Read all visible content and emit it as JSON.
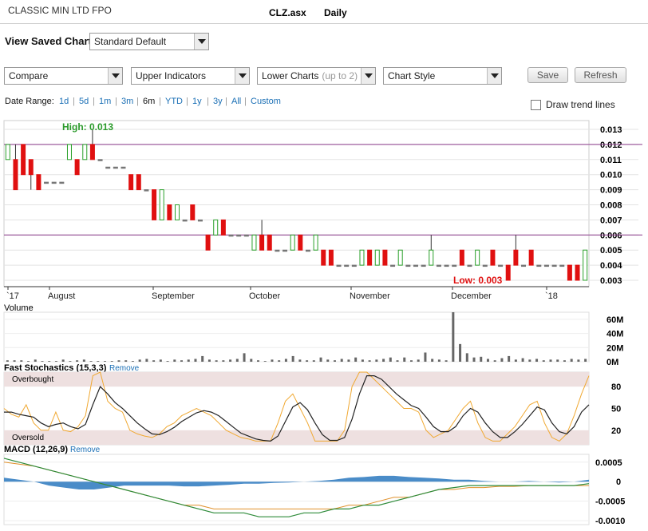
{
  "header": {
    "company": "CLASSIC MIN LTD FPO",
    "ticker": "CLZ.asx",
    "period": "Daily"
  },
  "saved_chart": {
    "label": "View Saved Chart:",
    "value": "Standard Default"
  },
  "toolbar": {
    "compare": "Compare",
    "upper": "Upper Indicators",
    "lower": "Lower Charts",
    "lower_hint": "(up to 2)",
    "style": "Chart Style",
    "save": "Save",
    "refresh": "Refresh"
  },
  "date_range": {
    "label": "Date Range:",
    "options": [
      "1d",
      "5d",
      "1m",
      "3m",
      "6m",
      "YTD",
      "1y",
      "3y",
      "All",
      "Custom"
    ],
    "selected": "6m"
  },
  "draw_trend": "Draw trend lines",
  "chart": {
    "high_label": "High: 0.013",
    "low_label": "Low: 0.003",
    "price_ticks": [
      "0.013",
      "0.012",
      "0.011",
      "0.010",
      "0.009",
      "0.008",
      "0.007",
      "0.006",
      "0.005",
      "0.004",
      "0.003"
    ],
    "x_labels": [
      "`17",
      "August",
      "September",
      "October",
      "November",
      "December",
      "`18"
    ],
    "volume_title": "Volume",
    "volume_ticks": [
      "60M",
      "40M",
      "20M",
      "0M"
    ],
    "stoch_title": "Fast Stochastics (15,3,3)",
    "stoch_remove": "Remove",
    "overbought": "Overbought",
    "oversold": "Oversold",
    "stoch_ticks": [
      "80",
      "50",
      "20"
    ],
    "macd_title": "MACD (12,26,9)",
    "macd_remove": "Remove",
    "macd_ticks": [
      "0.0005",
      "0",
      "-0.0005",
      "-0.0010"
    ],
    "colors": {
      "up": "#2aa02a",
      "down": "#e01010",
      "flat": "#777777",
      "trend": "#8b3a8b",
      "k_line": "#f0a830",
      "d_line": "#222222",
      "macd": "#2e8b3a",
      "signal": "#e0902a",
      "hist": "#4a8cc8"
    }
  },
  "chart_data": {
    "type": "candlestick",
    "y_range": [
      0.003,
      0.013
    ],
    "candles": [
      {
        "o": 0.011,
        "c": 0.012,
        "h": 0.012,
        "l": 0.011
      },
      {
        "o": 0.011,
        "c": 0.009,
        "h": 0.012,
        "l": 0.009
      },
      {
        "o": 0.012,
        "c": 0.01,
        "h": 0.012,
        "l": 0.01
      },
      {
        "o": 0.011,
        "c": 0.01,
        "h": 0.011,
        "l": 0.009
      },
      {
        "o": 0.01,
        "c": 0.009,
        "h": 0.01,
        "l": 0.009
      },
      {
        "o": 0.0095,
        "c": 0.0095,
        "h": 0.0095,
        "l": 0.0095
      },
      {
        "o": 0.0095,
        "c": 0.0095,
        "h": 0.0095,
        "l": 0.0095
      },
      {
        "o": 0.0095,
        "c": 0.0095,
        "h": 0.0095,
        "l": 0.0095
      },
      {
        "o": 0.011,
        "c": 0.012,
        "h": 0.012,
        "l": 0.011
      },
      {
        "o": 0.011,
        "c": 0.01,
        "h": 0.011,
        "l": 0.01
      },
      {
        "o": 0.011,
        "c": 0.012,
        "h": 0.012,
        "l": 0.011
      },
      {
        "o": 0.012,
        "c": 0.011,
        "h": 0.013,
        "l": 0.011
      },
      {
        "o": 0.011,
        "c": 0.011,
        "h": 0.011,
        "l": 0.011
      },
      {
        "o": 0.0105,
        "c": 0.0105,
        "h": 0.0105,
        "l": 0.0105
      },
      {
        "o": 0.0105,
        "c": 0.0105,
        "h": 0.0105,
        "l": 0.0105
      },
      {
        "o": 0.0105,
        "c": 0.0105,
        "h": 0.0105,
        "l": 0.0105
      },
      {
        "o": 0.01,
        "c": 0.009,
        "h": 0.01,
        "l": 0.009
      },
      {
        "o": 0.01,
        "c": 0.009,
        "h": 0.01,
        "l": 0.009
      },
      {
        "o": 0.009,
        "c": 0.009,
        "h": 0.009,
        "l": 0.009
      },
      {
        "o": 0.009,
        "c": 0.007,
        "h": 0.009,
        "l": 0.007
      },
      {
        "o": 0.007,
        "c": 0.009,
        "h": 0.009,
        "l": 0.007
      },
      {
        "o": 0.008,
        "c": 0.007,
        "h": 0.008,
        "l": 0.007
      },
      {
        "o": 0.007,
        "c": 0.008,
        "h": 0.008,
        "l": 0.007
      },
      {
        "o": 0.007,
        "c": 0.007,
        "h": 0.007,
        "l": 0.007
      },
      {
        "o": 0.008,
        "c": 0.007,
        "h": 0.008,
        "l": 0.007
      },
      {
        "o": 0.007,
        "c": 0.007,
        "h": 0.007,
        "l": 0.007
      },
      {
        "o": 0.006,
        "c": 0.005,
        "h": 0.006,
        "l": 0.005
      },
      {
        "o": 0.006,
        "c": 0.007,
        "h": 0.007,
        "l": 0.006
      },
      {
        "o": 0.007,
        "c": 0.006,
        "h": 0.007,
        "l": 0.006
      },
      {
        "o": 0.006,
        "c": 0.006,
        "h": 0.006,
        "l": 0.006
      },
      {
        "o": 0.006,
        "c": 0.006,
        "h": 0.006,
        "l": 0.006
      },
      {
        "o": 0.006,
        "c": 0.006,
        "h": 0.006,
        "l": 0.006
      },
      {
        "o": 0.005,
        "c": 0.006,
        "h": 0.006,
        "l": 0.005
      },
      {
        "o": 0.006,
        "c": 0.005,
        "h": 0.007,
        "l": 0.005
      },
      {
        "o": 0.006,
        "c": 0.005,
        "h": 0.006,
        "l": 0.005
      },
      {
        "o": 0.005,
        "c": 0.005,
        "h": 0.005,
        "l": 0.005
      },
      {
        "o": 0.005,
        "c": 0.005,
        "h": 0.005,
        "l": 0.005
      },
      {
        "o": 0.005,
        "c": 0.006,
        "h": 0.006,
        "l": 0.005
      },
      {
        "o": 0.006,
        "c": 0.005,
        "h": 0.006,
        "l": 0.005
      },
      {
        "o": 0.005,
        "c": 0.005,
        "h": 0.005,
        "l": 0.005
      },
      {
        "o": 0.005,
        "c": 0.006,
        "h": 0.006,
        "l": 0.005
      },
      {
        "o": 0.005,
        "c": 0.004,
        "h": 0.005,
        "l": 0.004
      },
      {
        "o": 0.005,
        "c": 0.004,
        "h": 0.005,
        "l": 0.004
      },
      {
        "o": 0.004,
        "c": 0.004,
        "h": 0.004,
        "l": 0.004
      },
      {
        "o": 0.004,
        "c": 0.004,
        "h": 0.004,
        "l": 0.004
      },
      {
        "o": 0.004,
        "c": 0.004,
        "h": 0.004,
        "l": 0.004
      },
      {
        "o": 0.004,
        "c": 0.005,
        "h": 0.005,
        "l": 0.004
      },
      {
        "o": 0.005,
        "c": 0.004,
        "h": 0.005,
        "l": 0.004
      },
      {
        "o": 0.004,
        "c": 0.005,
        "h": 0.005,
        "l": 0.004
      },
      {
        "o": 0.005,
        "c": 0.004,
        "h": 0.005,
        "l": 0.004
      },
      {
        "o": 0.004,
        "c": 0.004,
        "h": 0.004,
        "l": 0.004
      },
      {
        "o": 0.004,
        "c": 0.005,
        "h": 0.005,
        "l": 0.004
      },
      {
        "o": 0.004,
        "c": 0.004,
        "h": 0.004,
        "l": 0.004
      },
      {
        "o": 0.004,
        "c": 0.004,
        "h": 0.004,
        "l": 0.004
      },
      {
        "o": 0.004,
        "c": 0.004,
        "h": 0.004,
        "l": 0.004
      },
      {
        "o": 0.004,
        "c": 0.005,
        "h": 0.006,
        "l": 0.004
      },
      {
        "o": 0.004,
        "c": 0.004,
        "h": 0.004,
        "l": 0.004
      },
      {
        "o": 0.004,
        "c": 0.004,
        "h": 0.004,
        "l": 0.004
      },
      {
        "o": 0.004,
        "c": 0.004,
        "h": 0.004,
        "l": 0.004
      },
      {
        "o": 0.005,
        "c": 0.004,
        "h": 0.005,
        "l": 0.004
      },
      {
        "o": 0.004,
        "c": 0.004,
        "h": 0.004,
        "l": 0.004
      },
      {
        "o": 0.004,
        "c": 0.005,
        "h": 0.005,
        "l": 0.004
      },
      {
        "o": 0.004,
        "c": 0.004,
        "h": 0.004,
        "l": 0.004
      },
      {
        "o": 0.005,
        "c": 0.004,
        "h": 0.005,
        "l": 0.004
      },
      {
        "o": 0.004,
        "c": 0.004,
        "h": 0.004,
        "l": 0.004
      },
      {
        "o": 0.004,
        "c": 0.003,
        "h": 0.004,
        "l": 0.003
      },
      {
        "o": 0.005,
        "c": 0.004,
        "h": 0.006,
        "l": 0.004
      },
      {
        "o": 0.004,
        "c": 0.004,
        "h": 0.004,
        "l": 0.004
      },
      {
        "o": 0.005,
        "c": 0.004,
        "h": 0.005,
        "l": 0.004
      },
      {
        "o": 0.004,
        "c": 0.004,
        "h": 0.004,
        "l": 0.004
      },
      {
        "o": 0.004,
        "c": 0.004,
        "h": 0.004,
        "l": 0.004
      },
      {
        "o": 0.004,
        "c": 0.004,
        "h": 0.004,
        "l": 0.004
      },
      {
        "o": 0.004,
        "c": 0.004,
        "h": 0.004,
        "l": 0.004
      },
      {
        "o": 0.004,
        "c": 0.003,
        "h": 0.004,
        "l": 0.003
      },
      {
        "o": 0.004,
        "c": 0.003,
        "h": 0.004,
        "l": 0.003
      },
      {
        "o": 0.003,
        "c": 0.005,
        "h": 0.005,
        "l": 0.003
      }
    ],
    "trend_lines": [
      0.012,
      0.006
    ],
    "volume_M": [
      2,
      2,
      2,
      1,
      3,
      1,
      1,
      1,
      3,
      1,
      2,
      3,
      1,
      1,
      1,
      1,
      2,
      2,
      1,
      3,
      4,
      2,
      3,
      1,
      3,
      2,
      3,
      4,
      8,
      3,
      2,
      2,
      3,
      4,
      12,
      4,
      2,
      1,
      3,
      2,
      4,
      8,
      3,
      2,
      2,
      6,
      3,
      2,
      4,
      3,
      6,
      3,
      2,
      3,
      4,
      6,
      2,
      6,
      2,
      3,
      13,
      4,
      3,
      2,
      70,
      25,
      12,
      6,
      7,
      4,
      2,
      5,
      8,
      3,
      5,
      3,
      4,
      2,
      3,
      3,
      2,
      4,
      3,
      4
    ],
    "stoch_k": [
      50,
      42,
      38,
      55,
      30,
      20,
      20,
      45,
      20,
      18,
      25,
      40,
      95,
      100,
      60,
      50,
      45,
      20,
      15,
      12,
      10,
      15,
      25,
      30,
      40,
      45,
      50,
      45,
      40,
      30,
      20,
      15,
      10,
      8,
      5,
      5,
      5,
      30,
      60,
      70,
      50,
      30,
      5,
      5,
      5,
      5,
      20,
      80,
      100,
      100,
      90,
      80,
      70,
      60,
      50,
      50,
      45,
      20,
      10,
      15,
      20,
      35,
      50,
      60,
      30,
      10,
      5,
      5,
      15,
      25,
      40,
      55,
      60,
      30,
      10,
      5,
      15,
      40,
      70,
      95
    ],
    "stoch_d": [
      45,
      45,
      42,
      40,
      38,
      30,
      25,
      28,
      30,
      25,
      22,
      28,
      55,
      80,
      70,
      58,
      50,
      40,
      30,
      22,
      15,
      14,
      18,
      24,
      32,
      38,
      44,
      47,
      45,
      40,
      32,
      24,
      16,
      12,
      8,
      6,
      5,
      12,
      32,
      52,
      58,
      48,
      30,
      14,
      6,
      6,
      10,
      35,
      70,
      95,
      95,
      90,
      80,
      70,
      62,
      54,
      50,
      38,
      25,
      18,
      18,
      25,
      40,
      50,
      45,
      30,
      18,
      10,
      10,
      18,
      28,
      40,
      52,
      48,
      30,
      18,
      15,
      25,
      45,
      55
    ],
    "macd": [
      0.0006,
      0.0005,
      0.0004,
      0.0003,
      0.0002,
      0.0001,
      0.0,
      -0.0001,
      -0.0002,
      -0.0003,
      -0.0004,
      -0.0005,
      -0.0006,
      -0.0007,
      -0.0008,
      -0.0008,
      -0.0008,
      -0.0009,
      -0.0009,
      -0.0009,
      -0.0008,
      -0.0008,
      -0.0007,
      -0.0007,
      -0.0006,
      -0.0006,
      -0.0005,
      -0.0004,
      -0.0003,
      -0.0002,
      -0.00015,
      -0.0001,
      -0.0001,
      -0.0001,
      -0.0001,
      -0.0001,
      -0.0001,
      -0.0001,
      -0.0001,
      -5e-05
    ],
    "signal": [
      0.0005,
      0.00045,
      0.0004,
      0.0003,
      0.0002,
      0.0001,
      0.0,
      -0.0001,
      -0.0002,
      -0.0003,
      -0.0004,
      -0.0005,
      -0.0006,
      -0.0006,
      -0.0007,
      -0.0007,
      -0.0007,
      -0.0007,
      -0.0007,
      -0.0007,
      -0.0007,
      -0.0007,
      -0.0007,
      -0.0006,
      -0.0006,
      -0.0005,
      -0.0004,
      -0.0004,
      -0.0003,
      -0.0002,
      -0.0002,
      -0.00015,
      -0.00015,
      -0.00012,
      -0.00012,
      -0.0001,
      -0.0001,
      -0.0001,
      -0.0001,
      -0.0001
    ],
    "hist": [
      0.0001,
      5e-05,
      0.0,
      -0.0001,
      -0.00015,
      -0.0002,
      -0.0002,
      -0.00015,
      -0.0001,
      -0.0001,
      -0.0001,
      -0.0001,
      -0.00012,
      -0.00012,
      -0.0001,
      -8e-05,
      -5e-05,
      -5e-05,
      -3e-05,
      -2e-05,
      0.0,
      2e-05,
      5e-05,
      0.0001,
      0.00012,
      0.00015,
      0.00015,
      0.00012,
      0.0001,
      8e-05,
      5e-05,
      5e-05,
      2e-05,
      0.0,
      0.0,
      2e-05,
      0.0,
      -2e-05,
      0.0,
      5e-05
    ]
  }
}
